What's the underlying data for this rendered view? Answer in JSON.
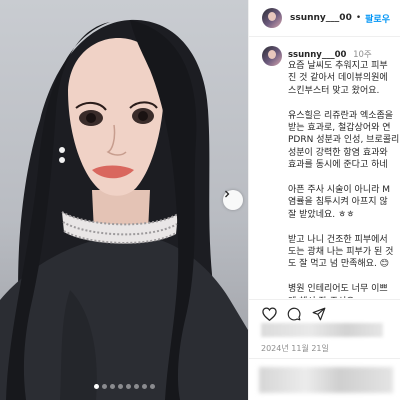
{
  "post": {
    "username": "ssunny___00",
    "follow_label": "팔로우",
    "separator": "•"
  },
  "caption": {
    "username": "ssunny___00",
    "time_ago": "10주",
    "lines": [
      "요즘 날씨도 추워지고 피부",
      "진 것 같아서 데이뷰의원에",
      "스킨부스터 맞고 왔어요.",
      "",
      "유스힐은 리쥬란과 엑소좀을",
      "받는 효과로, 철갑상어와 연",
      "PDRN 성분과 인성, 브로콜리",
      "성분이 강력한 항염 효과와",
      "효과를 동시에 준다고 하네",
      "",
      "아픈 주사 시술이 아니라 M",
      "염률을 침투시켜 아프지 않",
      "잘 받았네요. ㅎㅎ",
      "",
      "받고 나니 건조한 피부에서",
      "도는 광채 나는 피부가 된 것",
      "도 잘 먹고 넘 만족해요. 😊",
      "",
      "병원 인테리어도 너무 이쁘",
      "게 해서 잘 주셔요..."
    ]
  },
  "date_label": "2024년 11월 21일",
  "carousel": {
    "slides": 8,
    "active_index": 0
  },
  "icons": {
    "carousel_next": "chevron-right-icon",
    "like": "heart-icon",
    "comment": "comment-icon",
    "share": "share-icon"
  },
  "colors": {
    "accent": "#0095f6",
    "text": "#262626",
    "muted": "#8e8e8e",
    "divider": "#efefef"
  }
}
